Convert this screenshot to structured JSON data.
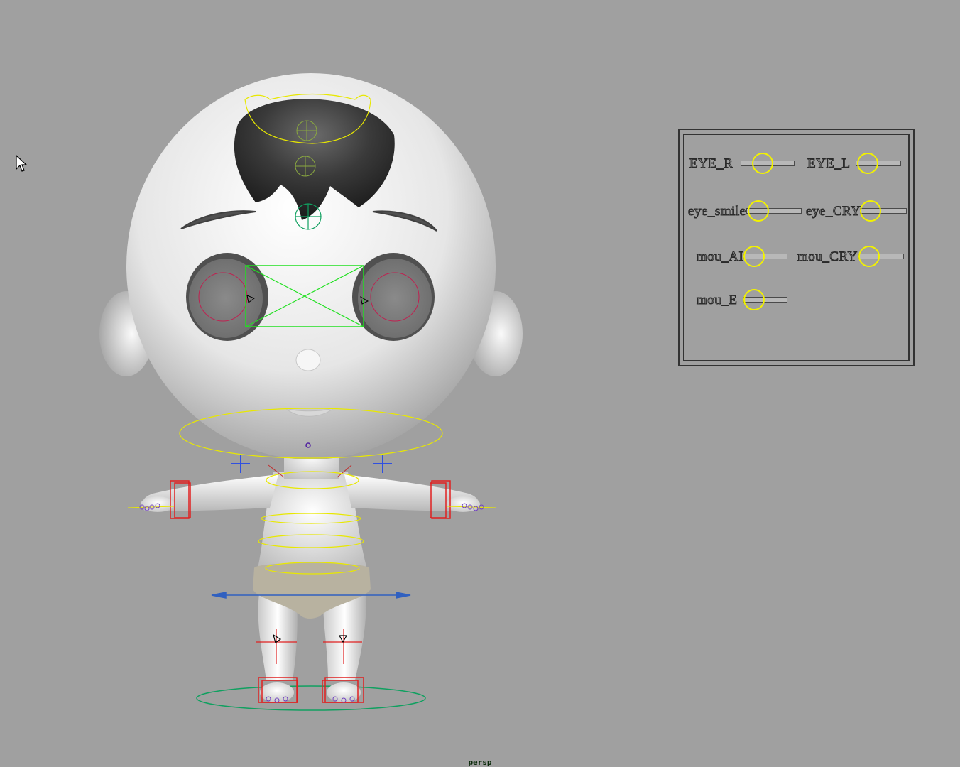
{
  "viewport": {
    "camera": "persp",
    "background": "#a0a0a0"
  },
  "character": {
    "skin_color": "#ececec",
    "diaper_color": "#b8b2a0",
    "control_colors": {
      "selection": "#e8e800",
      "ik": "#e02020",
      "pole": "#3050e0",
      "root": "#10a060",
      "eye_aim": "#20e020"
    }
  },
  "face_panel": {
    "sliders": [
      {
        "id": "eye_r",
        "label": "EYE_R"
      },
      {
        "id": "eye_l",
        "label": "EYE_L"
      },
      {
        "id": "eye_smile",
        "label": "eye_smile"
      },
      {
        "id": "eye_cry",
        "label": "eye_CRY"
      },
      {
        "id": "mou_ai",
        "label": "mou_AI"
      },
      {
        "id": "mou_cry",
        "label": "mou_CRY"
      },
      {
        "id": "mou_e",
        "label": "mou_E"
      }
    ]
  },
  "icons": {
    "cursor": "arrow-cursor-icon"
  }
}
